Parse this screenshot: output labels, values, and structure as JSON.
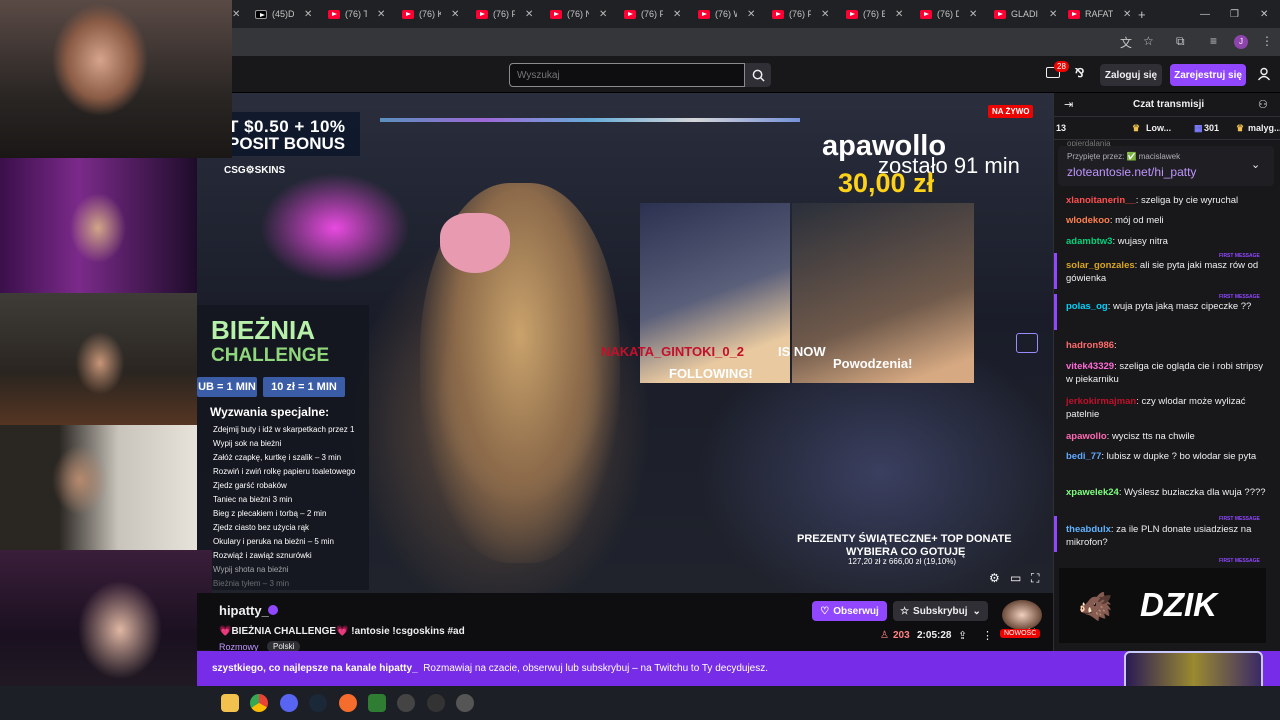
{
  "browser": {
    "tabs": [
      {
        "label": "(45)Da",
        "fav": "tiktok"
      },
      {
        "label": "(76) Th",
        "fav": "youtube"
      },
      {
        "label": "(76) Kl",
        "fav": "youtube"
      },
      {
        "label": "(76) Po",
        "fav": "youtube"
      },
      {
        "label": "(76) Na",
        "fav": "youtube"
      },
      {
        "label": "(76) Pa",
        "fav": "youtube"
      },
      {
        "label": "(76) W",
        "fav": "youtube"
      },
      {
        "label": "(76) PR",
        "fav": "youtube"
      },
      {
        "label": "(76) Bi",
        "fav": "youtube"
      },
      {
        "label": "(76) Dz",
        "fav": "youtube"
      },
      {
        "label": "GLADI",
        "fav": "youtube"
      },
      {
        "label": "RAFAT",
        "fav": "youtube"
      }
    ],
    "new_tab": "+",
    "profile_initial": "J"
  },
  "nav": {
    "search_placeholder": "Wyszukaj",
    "notifications_count": "28",
    "login_label": "Zaloguj się",
    "signup_label": "Zarejestruj się"
  },
  "video": {
    "live_badge": "NA ŻYWO",
    "bonus_line1": "T $0.50 + 10%",
    "bonus_line2": "POSIT BONUS",
    "csgo_label": "CSG⚙SKINS",
    "apa_name": "apawollo",
    "apa_left": "zostało 91 min",
    "apa_amount": "30,00 zł",
    "challenge_title1": "BIEŻNIA",
    "challenge_title2": "CHALLENGE",
    "chip1": "UB = 1 MIN",
    "chip2": "10 zł = 1 MIN",
    "challenge_sub": "Wyzwania specjalne:",
    "challenge_items": [
      "Zdejmij buty i idź w skarpetkach przez 1",
      "Wypij sok na bieżni",
      "Załóż czapkę, kurtkę i szalik – 3 min",
      "Rozwiń i zwiń rolkę papieru toaletowego",
      "Zjedz garść robaków",
      "Taniec na bieżni 3 min",
      "Bieg z plecakiem i torbą – 2 min",
      "Zjedz ciasto bez użycia rąk",
      "Okulary i peruka na bieżni – 5 min",
      "Rozwiąż i zawiąż sznurówki",
      "Wypij shota na bieżni",
      "Bieżnia tyłem – 3 min"
    ],
    "follow_name": "NAKATA_GINTOKI_0_2",
    "follow_is": "IS NOW",
    "follow_following": "FOLLOWING!",
    "powodzenia": "Powodzenia!",
    "gifts_line1": "PREZENTY ŚWIĄTECZNE+ TOP DONATE",
    "gifts_line2": "WYBIERA CO GOTUJĘ",
    "gifts_line3": "127,20 zł z 666,00 zł (19,10%)"
  },
  "stream": {
    "streamer": "hipatty_",
    "title": "💗BIEŻNIA CHALLENGE💗 !antosie !csgoskins #ad",
    "category": "Rozmowy",
    "language": "Polski",
    "follow_label": "Obserwuj",
    "sub_label": "Subskrybuj",
    "viewers": "203",
    "uptime": "2:05:28",
    "new_badge": "NOWOŚĆ"
  },
  "banner": {
    "bold": "szystkiego, co najlepsze na kanale hipatty_",
    "rest": "Rozmawiaj na czacie, obserwuj lub subskrybuj – na Twitchu to Ty decydujesz."
  },
  "chat": {
    "title": "Czat transmisji",
    "leaderboard": {
      "rank": "13",
      "user1": "Low...",
      "count": "301",
      "user2": "malyg..."
    },
    "overflow_text": "opierdalania",
    "pinned_by": "Przypięte przez: ✅ macislawek",
    "pinned_text": "zloteantosie.net/hi_patty",
    "first_message_label": "FIRST MESSAGE",
    "messages": [
      {
        "user": "xlanoitanerin__",
        "text": "szeliga by cie wyruchal",
        "color": "#ff4f4f"
      },
      {
        "user": "wlodekoo",
        "text": "mój od meli",
        "color": "#ff7f50"
      },
      {
        "user": "adambtw3",
        "text": "wujasy nitra",
        "color": "#00d27a"
      },
      {
        "user": "solar_gonzales",
        "text": "ali sie pyta jaki masz rów od gówienka",
        "color": "#daa520"
      },
      {
        "user": "polas_og",
        "text": "wuja pyta jaką masz cipeczke ??",
        "color": "#00d2ff"
      },
      {
        "user": "hadron986",
        "text": "",
        "color": "#ff6a6a"
      },
      {
        "user": "vitek43329",
        "text": "szeliga cie ogląda cie i robi stripsy w piekarniku",
        "color": "#ff6ad5"
      },
      {
        "user": "jerkokirmajman",
        "text": "czy wlodar może wylizać patelnie",
        "color": "#c0102a"
      },
      {
        "user": "apawollo",
        "text": "wycisz tts na chwile",
        "color": "#ff69b4"
      },
      {
        "user": "bedi_77",
        "text": "lubisz w dupke ? bo wlodar sie pyta",
        "color": "#5fa8ff"
      },
      {
        "user": "xpawelek24",
        "text": "Wyślesz buziaczka dla wuja ????",
        "color": "#7dff7d"
      },
      {
        "user": "theabdulx",
        "text": "za ile PLN donate usiadziesz na mikrofon?",
        "color": "#5fb3ff"
      }
    ],
    "dzik_label": "DZIK"
  },
  "colors": {
    "accent": "#9147ff",
    "live": "#eb0400",
    "banner": "#772ce8"
  }
}
